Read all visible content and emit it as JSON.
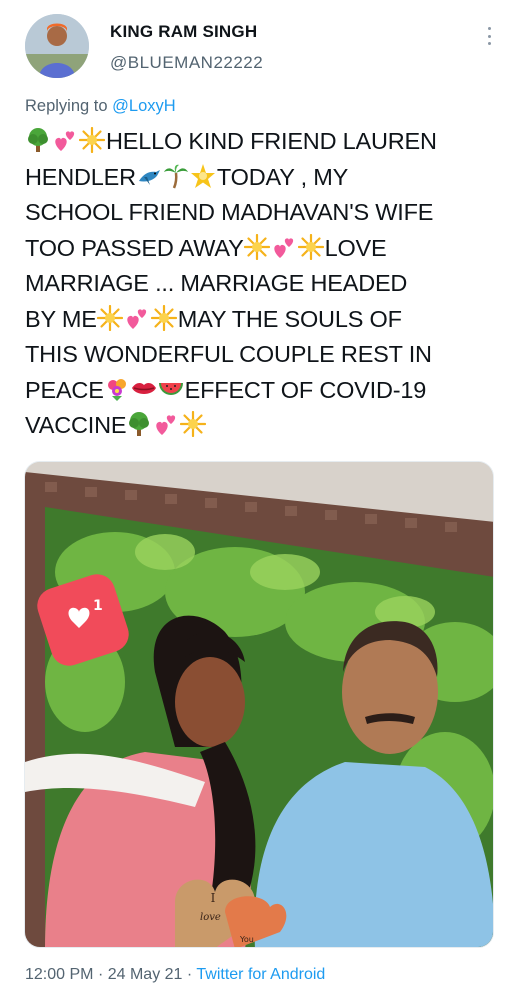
{
  "user": {
    "display_name": "KING RAM SINGH",
    "handle": "@BLUEMAN22222",
    "avatar_icon": "user-avatar-photo",
    "more_icon": "vertical-dots-icon"
  },
  "reply": {
    "prefix": "Replying to",
    "target": "@LoxyH"
  },
  "tweet": {
    "lines": [
      "HELLO KIND FRIEND LAUREN",
      "HENDLER",
      "TODAY , MY",
      "SCHOOL FRIEND MADHAVAN'S WIFE",
      "TOO PASSED AWAY",
      "LOVE",
      "MARRIAGE ... MARRIAGE HEADED",
      "BY ME",
      "MAY THE SOULS OF",
      "THIS WONDERFUL COUPLE REST IN",
      "PEACE",
      "EFFECT OF COVID-19",
      "VACCINE"
    ],
    "emoji_icons": [
      "tree-emoji",
      "two-hearts-emoji",
      "sparkle-emoji",
      "bird-emoji",
      "palm-tree-emoji",
      "star-emoji",
      "bouquet-emoji",
      "lips-emoji",
      "watermelon-emoji"
    ]
  },
  "media": {
    "overlay_like_count": "1",
    "sign_text_top": "I",
    "sign_text_mid": "love",
    "sign_text_bottom": "You"
  },
  "footer": {
    "time": "12:00 PM",
    "separator": "·",
    "date": "24 May 21",
    "source": "Twitter for Android"
  }
}
